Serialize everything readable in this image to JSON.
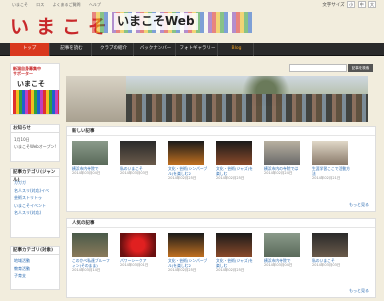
{
  "toplinks": [
    "いまこそ",
    "ロス",
    "よくあるご質問",
    "ヘルプ"
  ],
  "fontsize": {
    "label": "文字サイズ",
    "small": "小",
    "medium": "中",
    "large": "大"
  },
  "logo": "いまこそ",
  "banner_text": "いまこそWeb",
  "nav": [
    {
      "label": "トップ"
    },
    {
      "label": "記事を読む"
    },
    {
      "label": "クラブの紹介"
    },
    {
      "label": "バックナンバー"
    },
    {
      "label": "フォトギャラリー"
    },
    {
      "label": "Blog"
    }
  ],
  "promo": {
    "line1": "新潟自身募集中",
    "line2": "サポーター",
    "title": "いまこそWeb"
  },
  "sidebar": {
    "notice_title": "お知らせ",
    "notice_date": "1月10日",
    "notice_text": "いまこそWebオープン!",
    "categories_title": "記事カテゴリ(ジャンル)",
    "categories": [
      "ガガガ",
      "名人スリ(対応)イベ",
      "芸術ストリトゥ",
      "いまこそイベント",
      "名人スリ(対応)"
    ],
    "categories2_title": "記事カテゴリ(対象)",
    "categories2": [
      "地域活動",
      "教育活動",
      "子育支"
    ]
  },
  "search": {
    "placeholder": "",
    "button": "記事を検索"
  },
  "new_articles": {
    "title": "新しい記事",
    "more": "もっと見る",
    "items": [
      {
        "title": "横浜市内寺院で",
        "date": "2014年03月04日"
      },
      {
        "title": "私のいまこそ",
        "date": "2014年03月03日"
      },
      {
        "title": "文化・芸術(シンパーブル)を楽しむ2",
        "date": "2014年02月25日"
      },
      {
        "title": "文化・芸術(ジャズ)を楽しむ",
        "date": "2014年02月25日"
      },
      {
        "title": "横浜市内の寺院では",
        "date": "2014年02月24日"
      },
      {
        "title": "生涯学習ここで活動方法",
        "date": "2014年02月21日"
      }
    ]
  },
  "popular_articles": {
    "title": "人気の記事",
    "more": "もっと見る",
    "items": [
      {
        "title": "このかべ私達ブルーフィン(そのまま)",
        "date": "2014年03月14日"
      },
      {
        "title": "パワーシークア",
        "date": "2014年03月01日"
      },
      {
        "title": "文化・芸術(シンパーブル)を楽しむ2",
        "date": "2014年02月25日"
      },
      {
        "title": "文化・芸術(ジャズ)を楽しむ",
        "date": "2014年02月25日"
      },
      {
        "title": "横浜市内寺院で",
        "date": "2014年03月04日"
      },
      {
        "title": "私のいまこそ",
        "date": "2014年03月03日"
      }
    ]
  }
}
